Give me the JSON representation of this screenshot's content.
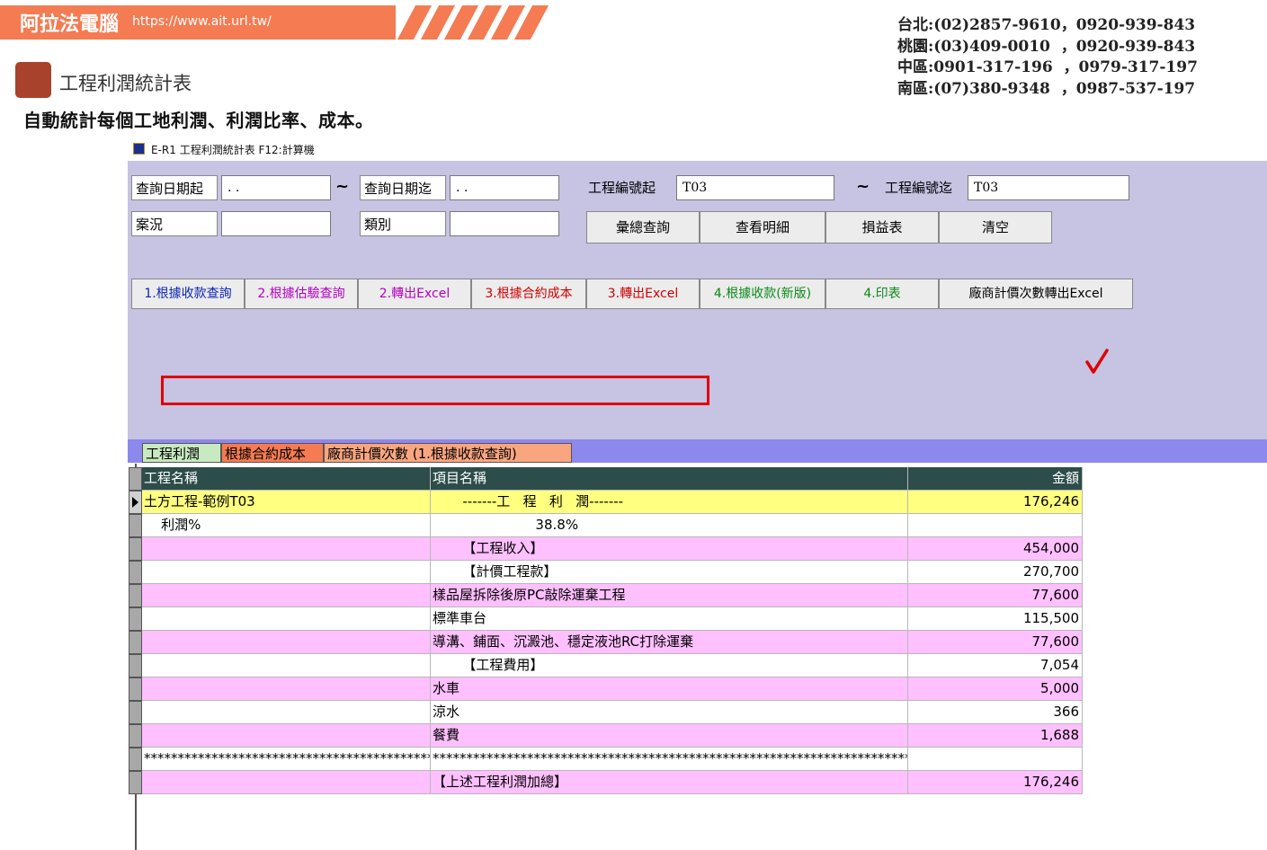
{
  "banner": {
    "brand": "阿拉法電腦",
    "url": "https://www.ait.url.tw/"
  },
  "phones": [
    "台北:(02)2857-9610，0920-939-843",
    "桃園:(03)409-0010  ，0920-939-843",
    "中區:0901-317-196  ，0979-317-197",
    "南區:(07)380-9348  ，0987-537-197"
  ],
  "page": {
    "title": "工程利潤統計表",
    "subtitle": "自動統計每個工地利潤、利潤比率、成本。"
  },
  "window": {
    "title": "E-R1 工程利潤統計表  F12:計算機"
  },
  "filters": {
    "date_from_label": "查詢日期起",
    "date_from_value": " . .",
    "tilde": "~",
    "date_to_label": "查詢日期迄",
    "date_to_value": " . .",
    "proj_from_label": "工程編號起",
    "proj_from_value": "T03",
    "proj_to_label": "工程編號迄",
    "proj_to_value": "T03",
    "case_label": "案況",
    "case_value": "",
    "category_label": "類別",
    "category_value": ""
  },
  "buttons": {
    "summary": "彙總查詢",
    "detail": "查看明細",
    "pl": "損益表",
    "clear": "清空"
  },
  "buttons2": [
    {
      "label": "1.根據收款查詢",
      "color": "blue"
    },
    {
      "label": "2.根據估驗查詢",
      "color": "magenta"
    },
    {
      "label": "2.轉出Excel",
      "color": "magenta"
    },
    {
      "label": "3.根據合約成本",
      "color": "red"
    },
    {
      "label": "3.轉出Excel",
      "color": "red"
    },
    {
      "label": "4.根據收款(新版)",
      "color": "green"
    },
    {
      "label": "4.印表",
      "color": "green"
    },
    {
      "label": "廠商計價次數轉出Excel",
      "color": "black"
    }
  ],
  "tabs": [
    "工程利潤",
    "根據合約成本",
    "廠商計價次數 (1.根據收款查詢)"
  ],
  "table": {
    "headers": [
      "工程名稱",
      "項目名稱",
      "金額"
    ],
    "rows": [
      {
        "c1": "土方工程-範例T03",
        "c2": "       -------工   程   利   潤-------",
        "c3": "176,246",
        "bg": "#ffff80",
        "current": true
      },
      {
        "c1": "    利潤%",
        "c2": "                        38.8%",
        "c3": "",
        "bg": "#ffffff"
      },
      {
        "c1": "",
        "c2": "       【工程收入】",
        "c3": "454,000",
        "bg": "#ffc0ff"
      },
      {
        "c1": "",
        "c2": "       【計價工程款】",
        "c3": "270,700",
        "bg": "#ffffff"
      },
      {
        "c1": "",
        "c2": "樣品屋拆除後原PC敲除運棄工程",
        "c3": "77,600",
        "bg": "#ffc0ff"
      },
      {
        "c1": "",
        "c2": "標準車台",
        "c3": "115,500",
        "bg": "#ffffff"
      },
      {
        "c1": "",
        "c2": "導溝、鋪面、沉澱池、穩定液池RC打除運棄",
        "c3": "77,600",
        "bg": "#ffc0ff"
      },
      {
        "c1": "",
        "c2": "       【工程費用】",
        "c3": "7,054",
        "bg": "#ffffff"
      },
      {
        "c1": "",
        "c2": "水車",
        "c3": "5,000",
        "bg": "#ffc0ff"
      },
      {
        "c1": "",
        "c2": "涼水",
        "c3": "366",
        "bg": "#ffffff"
      },
      {
        "c1": "",
        "c2": "餐費",
        "c3": "1,688",
        "bg": "#ffc0ff"
      },
      {
        "c1": "**************************************************",
        "c2": "********************************************************************************",
        "c3": "",
        "bg": "#ffffff"
      },
      {
        "c1": "",
        "c2": "【上述工程利潤加總】",
        "c3": "176,246",
        "bg": "#ffc0ff"
      }
    ]
  }
}
